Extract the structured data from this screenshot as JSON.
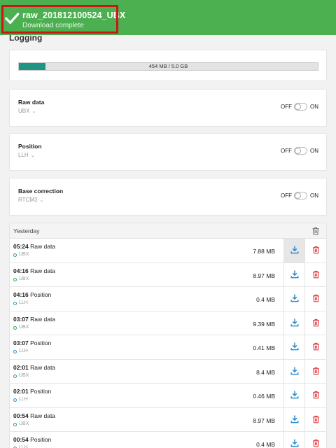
{
  "banner": {
    "title": "raw_201812100524_UBX",
    "subtitle": "Download complete",
    "icon": "check-icon",
    "color": "#4caf50"
  },
  "page_title": "Logging",
  "storage": {
    "text": "454 MB / 5.0 GB",
    "used_fraction": 0.089,
    "color": "#1e9582"
  },
  "settings": [
    {
      "label": "Raw data",
      "value": "UBX",
      "off": "OFF",
      "on": "ON",
      "enabled": false
    },
    {
      "label": "Position",
      "value": "LLH",
      "off": "OFF",
      "on": "ON",
      "enabled": false
    },
    {
      "label": "Base correction",
      "value": "RTCM3",
      "off": "OFF",
      "on": "ON",
      "enabled": false
    }
  ],
  "log": {
    "header": "Yesterday",
    "rows": [
      {
        "time": "05:24",
        "name": "Raw data",
        "format": "UBX",
        "size": "7.88 MB"
      },
      {
        "time": "04:16",
        "name": "Raw data",
        "format": "UBX",
        "size": "8.97 MB"
      },
      {
        "time": "04:16",
        "name": "Position",
        "format": "LLH",
        "size": "0.4 MB"
      },
      {
        "time": "03:07",
        "name": "Raw data",
        "format": "UBX",
        "size": "9.39 MB"
      },
      {
        "time": "03:07",
        "name": "Position",
        "format": "LLH",
        "size": "0.41 MB"
      },
      {
        "time": "02:01",
        "name": "Raw data",
        "format": "UBX",
        "size": "8.4 MB"
      },
      {
        "time": "02:01",
        "name": "Position",
        "format": "LLH",
        "size": "0.46 MB"
      },
      {
        "time": "00:54",
        "name": "Raw data",
        "format": "UBX",
        "size": "8.97 MB"
      },
      {
        "time": "00:54",
        "name": "Position",
        "format": "LLH",
        "size": "0.4 MB"
      }
    ]
  },
  "colors": {
    "download": "#2b8fd1",
    "delete": "#e0373e",
    "ubx": "#3aa24a",
    "llh": "#2d90c8"
  }
}
